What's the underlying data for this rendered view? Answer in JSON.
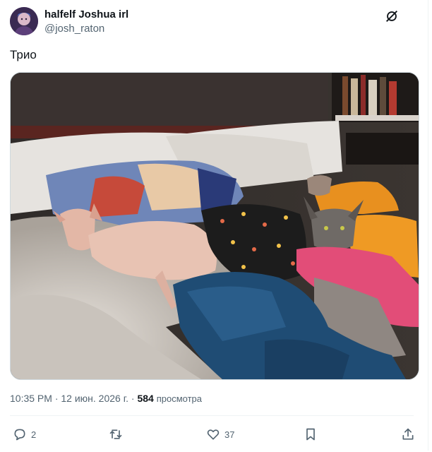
{
  "tweet": {
    "display_name": "halfelf Joshua irl",
    "handle": "@josh_raton",
    "text": "Трио",
    "time": "10:35 PM",
    "separator": "·",
    "date": "12 июн. 2026 г.",
    "views_count": "584",
    "views_label": "просмотра"
  },
  "actions": {
    "reply": {
      "icon": "reply-icon",
      "count": "2"
    },
    "retweet": {
      "icon": "retweet-icon",
      "count": ""
    },
    "like": {
      "icon": "heart-icon",
      "count": "37"
    },
    "bookmark": {
      "icon": "bookmark-icon"
    },
    "share": {
      "icon": "share-icon"
    }
  },
  "icons": {
    "grok": "grok-icon"
  },
  "colors": {
    "text": "#0f1419",
    "secondary": "#536471",
    "divider": "#eff3f4",
    "media_border": "#cfd9de"
  }
}
